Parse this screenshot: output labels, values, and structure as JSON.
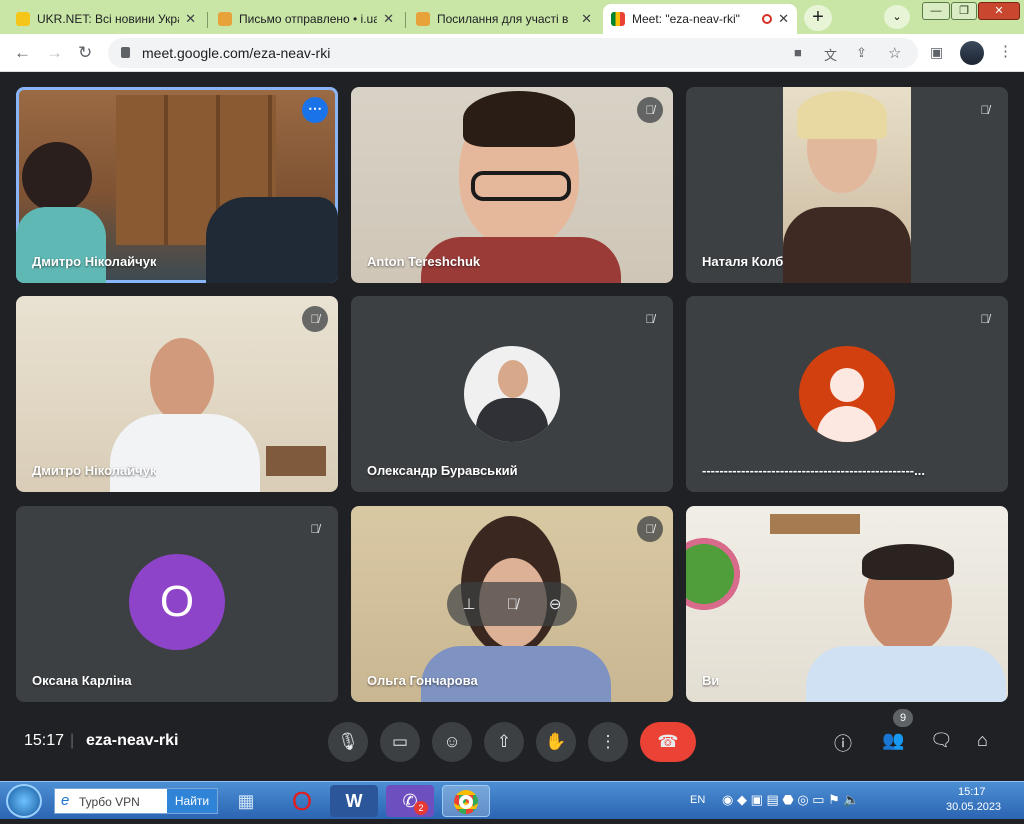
{
  "browser": {
    "tabs": [
      {
        "title": "UKR.NET: Всі новини України"
      },
      {
        "title": "Письмо отправлено • i.ua"
      },
      {
        "title": "Посилання для участі в"
      },
      {
        "title": "Meet: \"eza-neav-rki\""
      }
    ],
    "url": "meet.google.com/eza-neav-rki",
    "new_tab": "+",
    "tab_menu": "⌄"
  },
  "meet": {
    "participants": [
      {
        "name": "Дмитро Ніколайчук",
        "muted": false,
        "speaking": true
      },
      {
        "name": "Anton Tereshchuk",
        "muted": true
      },
      {
        "name": "Наталя Колб",
        "muted": true
      },
      {
        "name": "Дмитро Ніколайчук",
        "muted": true
      },
      {
        "name": "Олександр Буравський",
        "muted": true
      },
      {
        "name": "-------------------------------------------------...",
        "muted": true
      },
      {
        "name": "Оксана Карліна",
        "muted": true,
        "initial": "О"
      },
      {
        "name": "Ольга Гончарова",
        "muted": true
      },
      {
        "name": "Ви",
        "muted": false
      }
    ],
    "time": "15:17",
    "meeting_code": "eza-neav-rki",
    "participant_count": "9",
    "accent_color": "#8ab4f8",
    "end_call_color": "#ea4335"
  },
  "taskbar": {
    "vpn_label": "Турбо VPN",
    "search_button": "Найти",
    "viber_badge": "2",
    "language": "EN",
    "clock_time": "15:17",
    "clock_date": "30.05.2023"
  }
}
